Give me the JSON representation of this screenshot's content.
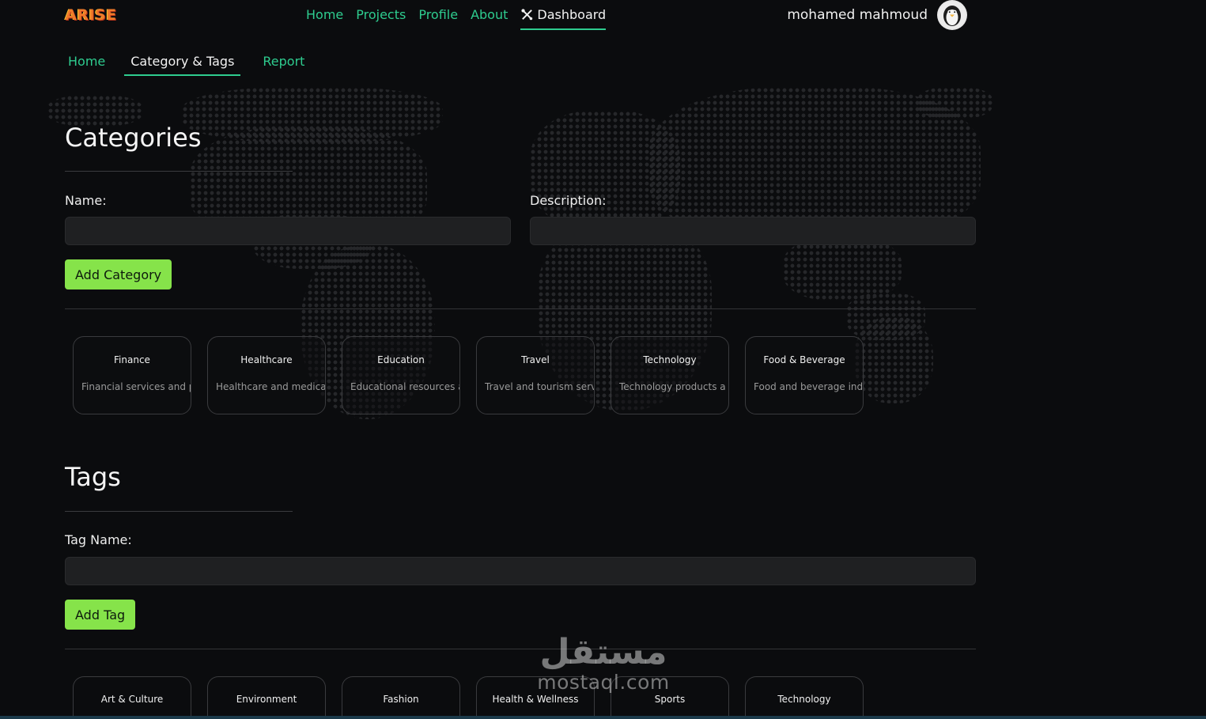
{
  "app": {
    "logo": "ARISE"
  },
  "nav": {
    "items": [
      {
        "label": "Home"
      },
      {
        "label": "Projects"
      },
      {
        "label": "Profile"
      },
      {
        "label": "About"
      },
      {
        "label": "Dashboard"
      }
    ],
    "active": "Dashboard"
  },
  "user": {
    "name": "mohamed mahmoud"
  },
  "subnav": {
    "items": [
      {
        "label": "Home"
      },
      {
        "label": "Category & Tags"
      },
      {
        "label": "Report"
      }
    ],
    "active": "Category & Tags"
  },
  "categories": {
    "title": "Categories",
    "name_label": "Name:",
    "description_label": "Description:",
    "name_value": "",
    "description_value": "",
    "add_button": "Add Category",
    "items": [
      {
        "name": "Finance",
        "description": "Financial services and p"
      },
      {
        "name": "Healthcare",
        "description": "Healthcare and medica"
      },
      {
        "name": "Education",
        "description": "Educational resources a"
      },
      {
        "name": "Travel",
        "description": "Travel and tourism serv"
      },
      {
        "name": "Technology",
        "description": "Technology products a"
      },
      {
        "name": "Food & Beverage",
        "description": "Food and beverage ind"
      }
    ]
  },
  "tags": {
    "title": "Tags",
    "tag_label": "Tag Name:",
    "tag_value": "",
    "add_button": "Add Tag",
    "items": [
      {
        "name": "Art & Culture"
      },
      {
        "name": "Environment"
      },
      {
        "name": "Fashion"
      },
      {
        "name": "Health & Wellness"
      },
      {
        "name": "Sports"
      },
      {
        "name": "Technology"
      }
    ]
  },
  "watermark": {
    "arabic": "مستقل",
    "latin": "mostaql.com"
  },
  "colors": {
    "accent": "#2ecc8f",
    "button": "#86e34a",
    "background": "#0b0c0e",
    "logo": "#f07a2a"
  }
}
